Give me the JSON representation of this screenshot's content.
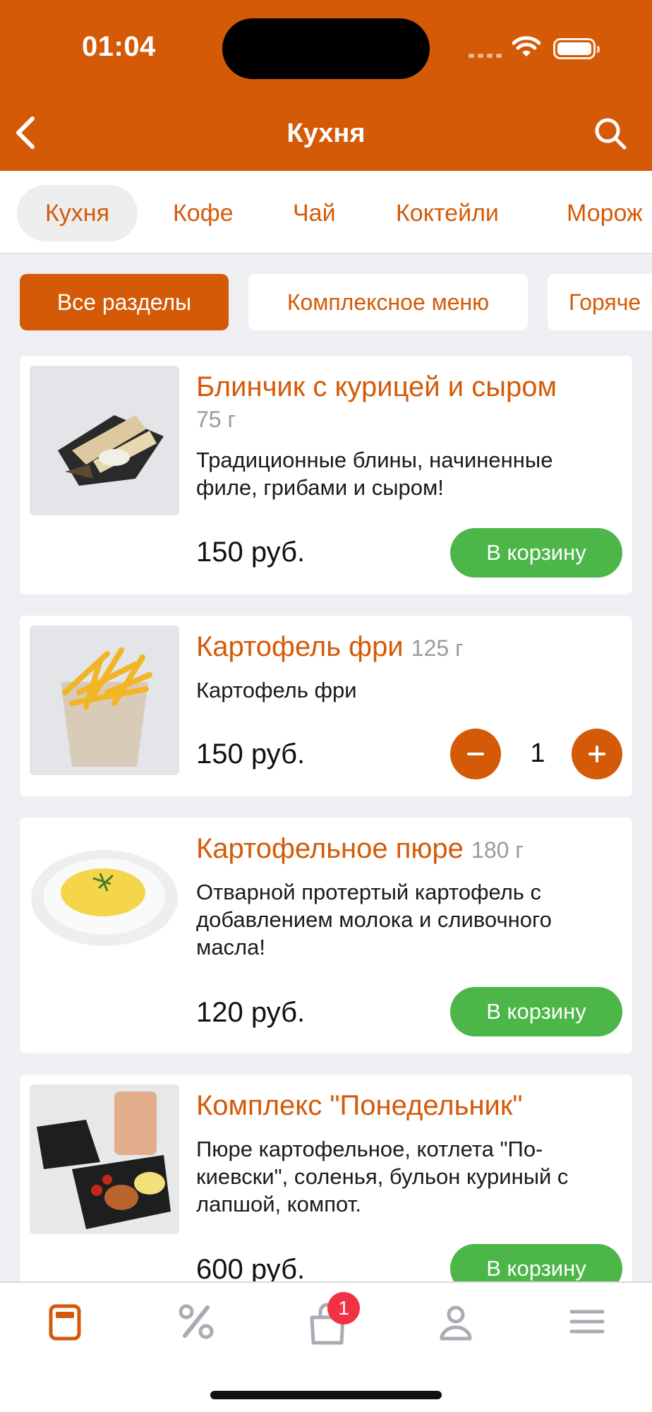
{
  "status": {
    "time": "01:04"
  },
  "header": {
    "title": "Кухня"
  },
  "categories": [
    "Кухня",
    "Кофе",
    "Чай",
    "Коктейли",
    "Морож"
  ],
  "sections": [
    "Все разделы",
    "Комплексное меню",
    "Горяче"
  ],
  "items": [
    {
      "name": "Блинчик с курицей и сыром",
      "weight": "75 г",
      "description": "Традиционные блины, начиненные филе, грибами и сыром!",
      "price": "150 руб.",
      "action": "В корзину"
    },
    {
      "name": "Картофель фри",
      "weight": "125 г",
      "description": "Картофель фри",
      "price": "150 руб.",
      "quantity": "1"
    },
    {
      "name": "Картофельное пюре",
      "weight": "180 г",
      "description": "Отварной протертый картофель с добавлением молока и сливочного масла!",
      "price": "120 руб.",
      "action": "В корзину"
    },
    {
      "name": "Комплекс \"Понедельник\"",
      "description": "Пюре картофельное, котлета \"По-киевски\", соленья, бульон куриный с лапшой, компот.",
      "price": "600 руб.",
      "action": "В корзину"
    }
  ],
  "tabbar": {
    "cart_badge": "1"
  },
  "colors": {
    "brand": "#d45a08",
    "add_button": "#4cb648",
    "badge": "#f23244"
  }
}
